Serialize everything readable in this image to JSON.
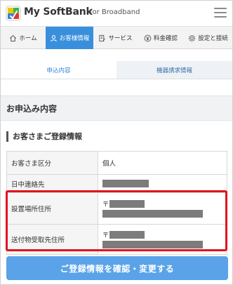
{
  "header": {
    "brand": "My SoftBank",
    "brand_sub": "for Broadband",
    "logo_colors": [
      "#f5c400",
      "#3cb44b",
      "#2f86d6",
      "#e5342b"
    ]
  },
  "nav": {
    "items": [
      {
        "label": "ホーム",
        "icon": "home-icon"
      },
      {
        "label": "お客様情報",
        "icon": "person-icon",
        "active": true
      },
      {
        "label": "サービス",
        "icon": "document-icon"
      },
      {
        "label": "料金確認",
        "icon": "yen-icon"
      },
      {
        "label": "設定と接続",
        "icon": "gear-icon"
      }
    ],
    "active_color": "#3a8fdc"
  },
  "subtabs": [
    {
      "label": "申込内容",
      "active": true
    },
    {
      "label": "機器請求情報",
      "active": false
    }
  ],
  "section_title": "お申込み内容",
  "sub_title": "お客さまご登録情報",
  "table": {
    "rows": [
      {
        "label": "お客さま区分",
        "value": "個人"
      },
      {
        "label": "日中連絡先",
        "value": ""
      },
      {
        "label": "設置場所住所",
        "postal_mark": "〒",
        "value": ""
      },
      {
        "label": "送付物受取先住所",
        "postal_mark": "〒",
        "value": ""
      }
    ]
  },
  "highlight_color": "#e0141e",
  "cta": {
    "label": "ご登録情報を確認・変更する",
    "color": "#5aa3e8"
  }
}
